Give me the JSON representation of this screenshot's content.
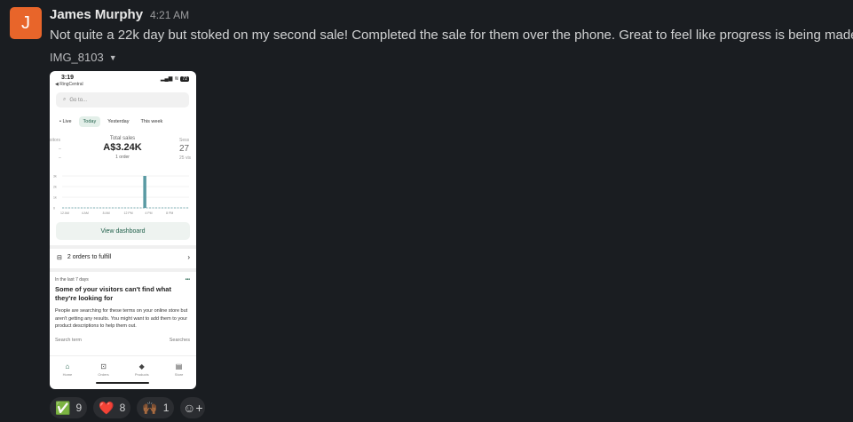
{
  "message": {
    "avatar_letter": "J",
    "avatar_color": "#e8652a",
    "author": "James Murphy",
    "time": "4:21 AM",
    "text": "Not quite a 22k day but stoked on my second sale! Completed the sale for them over the phone. Great to feel like progress is being made",
    "attachment_name": "IMG_8103"
  },
  "screenshot": {
    "status_time": "3:19",
    "back_label": "◀ RingCentral",
    "battery": "72",
    "search_placeholder": "Go to...",
    "tabs": [
      "• Live",
      "Today",
      "Yesterday",
      "This week"
    ],
    "active_tab": "Today",
    "stat_left": {
      "label": "sitors",
      "value": "–",
      "sub": "–"
    },
    "stat_mid": {
      "label": "Total sales",
      "value": "A$3.24K",
      "sub": "1 order"
    },
    "stat_right": {
      "label": "Sess",
      "value": "27",
      "sub": "25 vis"
    },
    "chart_data": {
      "type": "bar",
      "y_ticks": [
        "3k",
        "2k",
        "1k",
        "0"
      ],
      "x_ticks": [
        "12 AM",
        "4 AM",
        "8 AM",
        "12 PM",
        "4 PM",
        "8 PM"
      ],
      "categories": [
        "12 AM",
        "1 AM",
        "2 AM",
        "3 AM",
        "4 AM",
        "5 AM",
        "6 AM",
        "7 AM",
        "8 AM",
        "9 AM",
        "10 AM",
        "11 AM",
        "12 PM",
        "1 PM",
        "2 PM",
        "3 PM",
        "4 PM",
        "5 PM",
        "6 PM",
        "7 PM",
        "8 PM",
        "9 PM",
        "10 PM",
        "11 PM"
      ],
      "values": [
        0,
        0,
        0,
        0,
        0,
        0,
        0,
        0,
        0,
        0,
        0,
        0,
        0,
        0,
        0,
        3240,
        0,
        0,
        0,
        0,
        0,
        0,
        0,
        0
      ],
      "ylim": [
        0,
        3000
      ],
      "bar_color": "#5a9aa3"
    },
    "dashboard_button": "View dashboard",
    "orders_label": "2 orders to fulfill",
    "insight": {
      "period": "In the last 7 days",
      "menu": "•••",
      "title": "Some of your visitors can't find what they're looking for",
      "body": "People are searching for these terms on your online store but aren't getting any results. You might want to add them to your product descriptions to help them out.",
      "col_left": "Search term",
      "col_right": "Searches"
    },
    "nav": [
      {
        "label": "Home",
        "icon": "home-icon"
      },
      {
        "label": "Orders",
        "icon": "orders-icon"
      },
      {
        "label": "Products",
        "icon": "tag-icon"
      },
      {
        "label": "Store",
        "icon": "store-icon"
      }
    ]
  },
  "reactions": [
    {
      "emoji": "✅",
      "name": "white-check-mark",
      "count": "9"
    },
    {
      "emoji": "❤️",
      "name": "heart",
      "count": "8"
    },
    {
      "emoji": "🙌🏾",
      "name": "raised-hands",
      "count": "1"
    }
  ],
  "add_reaction_icon": "add-emoji-icon"
}
